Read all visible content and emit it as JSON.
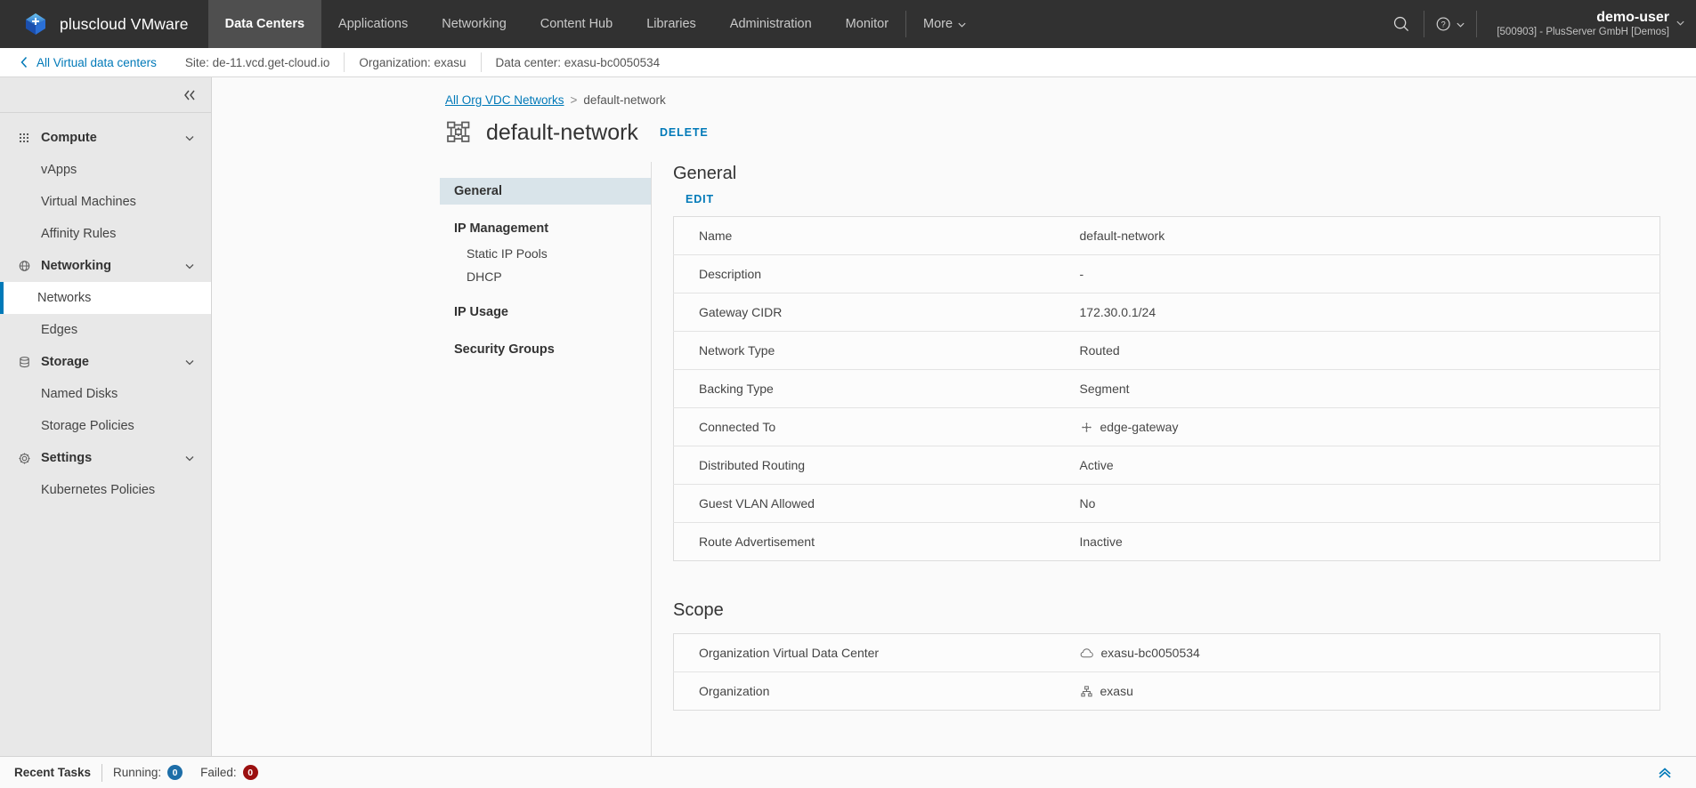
{
  "header": {
    "brand": "pluscloud VMware",
    "brand_logo_icon": "plus-cube-logo-icon",
    "nav": [
      {
        "label": "Data Centers",
        "active": true
      },
      {
        "label": "Applications",
        "active": false
      },
      {
        "label": "Networking",
        "active": false
      },
      {
        "label": "Content Hub",
        "active": false
      },
      {
        "label": "Libraries",
        "active": false
      },
      {
        "label": "Administration",
        "active": false
      },
      {
        "label": "Monitor",
        "active": false
      }
    ],
    "more_label": "More",
    "search_icon": "search-icon",
    "help_icon": "help-circle-icon",
    "user_name": "demo-user",
    "user_org": "[500903] - PlusServer GmbH [Demos]"
  },
  "subbar": {
    "back_label": "All Virtual data centers",
    "back_icon": "chevron-left-icon",
    "items": [
      "Site: de-11.vcd.get-cloud.io",
      "Organization: exasu",
      "Data center: exasu-bc0050534"
    ]
  },
  "sidebar": {
    "collapse_icon": "double-chevron-left-icon",
    "sections": [
      {
        "label": "Compute",
        "icon": "grid-dots-icon",
        "expanded": true,
        "items": [
          {
            "label": "vApps",
            "active": false
          },
          {
            "label": "Virtual Machines",
            "active": false
          },
          {
            "label": "Affinity Rules",
            "active": false
          }
        ]
      },
      {
        "label": "Networking",
        "icon": "globe-icon",
        "expanded": true,
        "items": [
          {
            "label": "Networks",
            "active": true
          },
          {
            "label": "Edges",
            "active": false
          }
        ]
      },
      {
        "label": "Storage",
        "icon": "database-icon",
        "expanded": true,
        "items": [
          {
            "label": "Named Disks",
            "active": false
          },
          {
            "label": "Storage Policies",
            "active": false
          }
        ]
      },
      {
        "label": "Settings",
        "icon": "gear-icon",
        "expanded": true,
        "items": [
          {
            "label": "Kubernetes Policies",
            "active": false
          }
        ]
      }
    ]
  },
  "page": {
    "breadcrumb_link": "All Org VDC Networks",
    "breadcrumb_separator": ">",
    "breadcrumb_current": "default-network",
    "title": "default-network",
    "title_icon": "network-grid-icon",
    "delete_label": "DELETE"
  },
  "detail_nav": {
    "items": [
      {
        "label": "General",
        "type": "head",
        "active": true
      },
      {
        "label": "IP Management",
        "type": "head",
        "active": false
      },
      {
        "label": "Static IP Pools",
        "type": "sub",
        "active": false
      },
      {
        "label": "DHCP",
        "type": "sub",
        "active": false
      },
      {
        "label": "IP Usage",
        "type": "head",
        "active": false
      },
      {
        "label": "Security Groups",
        "type": "head",
        "active": false
      }
    ]
  },
  "general": {
    "title": "General",
    "edit_label": "EDIT",
    "rows": [
      {
        "key": "Name",
        "value": "default-network",
        "icon": ""
      },
      {
        "key": "Description",
        "value": "-",
        "icon": ""
      },
      {
        "key": "Gateway CIDR",
        "value": "172.30.0.1/24",
        "icon": ""
      },
      {
        "key": "Network Type",
        "value": "Routed",
        "icon": ""
      },
      {
        "key": "Backing Type",
        "value": "Segment",
        "icon": ""
      },
      {
        "key": "Connected To",
        "value": "edge-gateway",
        "icon": "edge-gateway-icon"
      },
      {
        "key": "Distributed Routing",
        "value": "Active",
        "icon": ""
      },
      {
        "key": "Guest VLAN Allowed",
        "value": "No",
        "icon": ""
      },
      {
        "key": "Route Advertisement",
        "value": "Inactive",
        "icon": ""
      }
    ]
  },
  "scope": {
    "title": "Scope",
    "rows": [
      {
        "key": "Organization Virtual Data Center",
        "value": "exasu-bc0050534",
        "icon": "cloud-icon"
      },
      {
        "key": "Organization",
        "value": "exasu",
        "icon": "org-tree-icon"
      }
    ]
  },
  "bottombar": {
    "title": "Recent Tasks",
    "running_label": "Running:",
    "running_count": "0",
    "running_color": "#1d6ea8",
    "failed_label": "Failed:",
    "failed_count": "0",
    "failed_color": "#9b1010",
    "expand_icon": "double-chevron-up-icon"
  }
}
